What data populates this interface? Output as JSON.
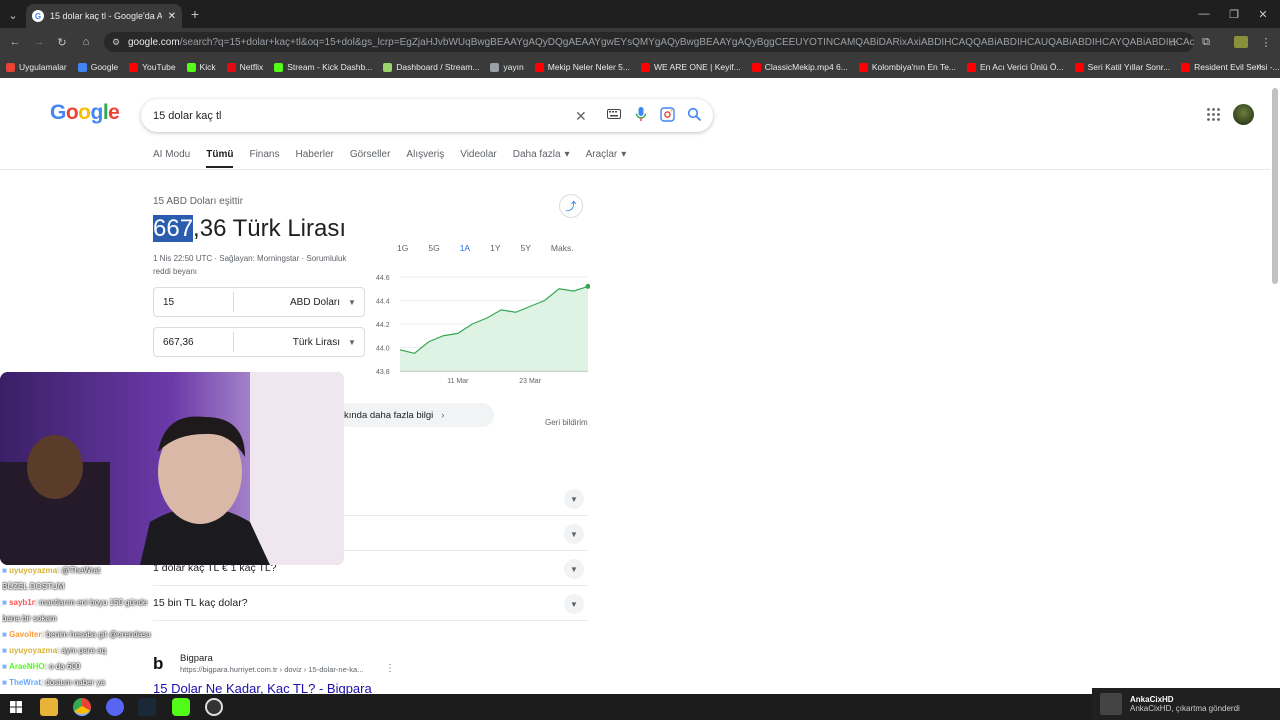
{
  "browser": {
    "tab_title": "15 dolar kaç tl - Google'da Ara",
    "url_host": "google.com",
    "url_path": "/search?q=15+dolar+kaç+tl&oq=15+dol&gs_lcrp=EgZjaHJvbWUqBwgBEAAYgAQyDQgAEAAYgwEYsQMYgAQyBwgBEAAYgAQyBggCEEUYOTINCAMQABiDARixAxiABDIHCAQQABiABDIHCAUQABiABDIHCAYQABiABDIHCAcQABiABDIHCAg...",
    "bookmarks": [
      {
        "label": "Uygulamalar",
        "color": "#ea4335"
      },
      {
        "label": "Google",
        "color": "#4285f4"
      },
      {
        "label": "YouTube",
        "color": "#ff0000"
      },
      {
        "label": "Kick",
        "color": "#53fc18"
      },
      {
        "label": "Netflix",
        "color": "#e50914"
      },
      {
        "label": "Stream - Kick Dashb...",
        "color": "#53fc18"
      },
      {
        "label": "Dashboard / Stream...",
        "color": "#9bd26c"
      },
      {
        "label": "yayın",
        "color": "#9aa0a6"
      },
      {
        "label": "Mekip Neler Neler 5...",
        "color": "#ff0000"
      },
      {
        "label": "WE ARE ONE | Keyif...",
        "color": "#ff0000"
      },
      {
        "label": "ClassicMekip.mp4 6...",
        "color": "#ff0000"
      },
      {
        "label": "Kolombiya'nın En Te...",
        "color": "#ff0000"
      },
      {
        "label": "En Acı Verici Ünlü Ö...",
        "color": "#ff0000"
      },
      {
        "label": "Seri Katil Yıllar Sonr...",
        "color": "#ff0000"
      },
      {
        "label": "Resident Evil Serisi -...",
        "color": "#ff0000"
      }
    ]
  },
  "search": {
    "query": "15 dolar kaç tl",
    "nav": [
      "AI Modu",
      "Tümü",
      "Finans",
      "Haberler",
      "Görseller",
      "Alışveriş",
      "Videolar",
      "Daha fazla",
      "Araçlar"
    ]
  },
  "converter": {
    "subtitle": "15 ABD Doları eşittir",
    "value_selected": "667",
    "value_rest": ",36 Türk Lirası",
    "meta": "1 Nis 22:50 UTC · Sağlayan: Morningstar · Sorumluluk reddi beyanı",
    "from_amount": "15",
    "from_currency": "ABD Doları",
    "to_amount": "667,36",
    "to_currency": "Türk Lirası",
    "ranges": [
      "1G",
      "5G",
      "1A",
      "1Y",
      "5Y",
      "Maks."
    ],
    "more_info": "kında daha fazla bilgi",
    "feedback": "Geri bildirim"
  },
  "chart_data": {
    "type": "area",
    "x": [
      "1 Mar",
      "4 Mar",
      "6 Mar",
      "9 Mar",
      "11 Mar",
      "13 Mar",
      "16 Mar",
      "18 Mar",
      "20 Mar",
      "23 Mar",
      "25 Mar",
      "27 Mar",
      "30 Mar",
      "1 Nis"
    ],
    "series": [
      {
        "values": [
          43.98,
          43.95,
          44.05,
          44.1,
          44.12,
          44.2,
          44.25,
          44.32,
          44.3,
          44.35,
          44.4,
          44.5,
          44.48,
          44.52
        ]
      }
    ],
    "ylim": [
      43.8,
      44.6
    ],
    "yticks": [
      "44.6",
      "44.4",
      "44.2",
      "44.0",
      "43.8"
    ],
    "xticks": [
      "11 Mar",
      "23 Mar"
    ],
    "accent": "#34a853"
  },
  "faq": [
    "",
    "",
    "1 dolar kaç TL € 1 kaç TL?",
    "15 bin TL kaç dolar?"
  ],
  "result": {
    "source_name": "Bigpara",
    "source_url": "https://bigpara.hurriyet.com.tr › doviz › 15-dolar-ne-ka...",
    "title": "15 Dolar Ne Kadar, Kac TL? - Bigpara"
  },
  "chat": [
    {
      "user": "uyuyoyazma",
      "color": "#d8b33a",
      "text": ": @TheWrat"
    },
    {
      "user": "",
      "color": "#ffffff",
      "text": "BÜZEL DOSTUM"
    },
    {
      "user": "sayb1r",
      "color": "#ff5050",
      "text": ": mantlarım eni boyu 150 günde"
    },
    {
      "user": "",
      "color": "#ffffff",
      "text": "bana bir sokam"
    },
    {
      "user": "Gavolter",
      "color": "#ff9b3a",
      "text": ": benim hesaba git @orendasu"
    },
    {
      "user": "uyuyoyazma",
      "color": "#d8b33a",
      "text": ": aynı para aq"
    },
    {
      "user": "AraeNHO",
      "color": "#53fc18",
      "text": ": o da 600"
    },
    {
      "user": "TheWrat",
      "color": "#6aa8ff",
      "text": ": dostum naber ya"
    }
  ],
  "notification": {
    "name": "AnkaCixHD",
    "message": "AnkaCixHD, çıkartma gönderdi"
  }
}
